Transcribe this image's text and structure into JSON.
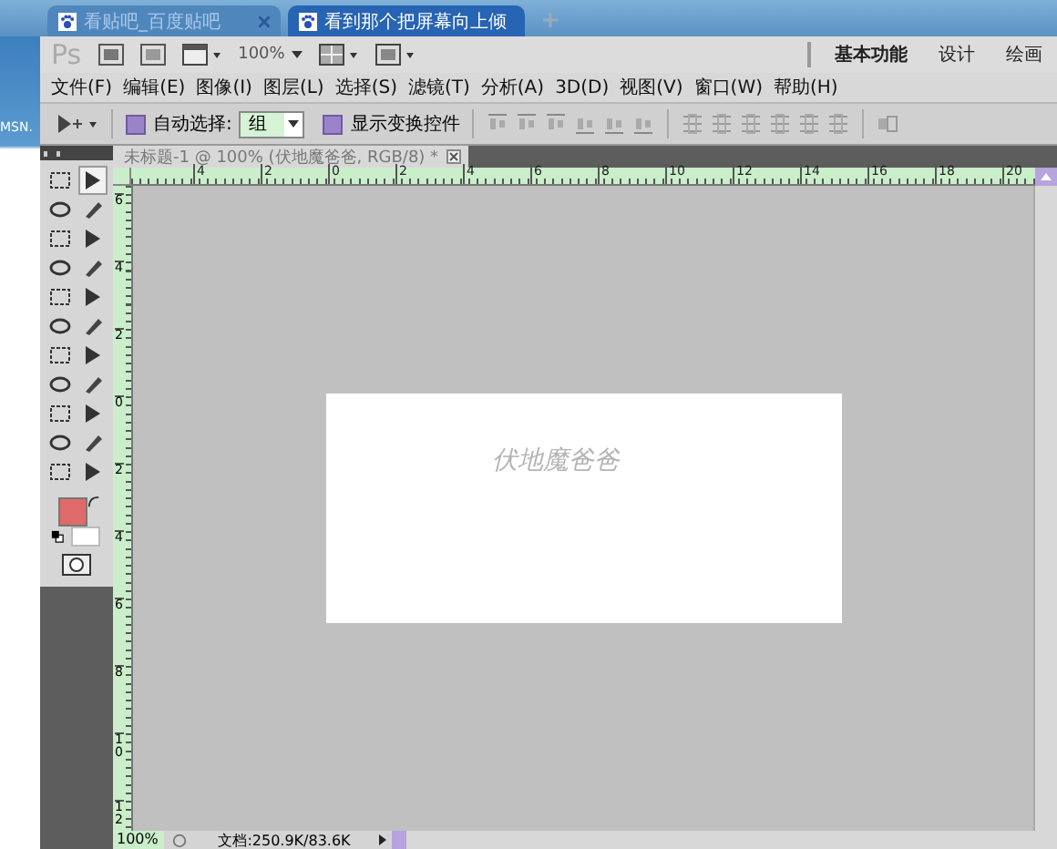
{
  "browser_tabs": [
    {
      "label": "看贴吧_百度贴吧",
      "selected": false
    },
    {
      "label": "看到那个把屏幕向上倾",
      "selected": true
    }
  ],
  "desktop": {
    "label": "MSN."
  },
  "app_bar": {
    "logo": "Ps",
    "zoom": "100%",
    "workspaces": [
      {
        "label": "基本功能",
        "selected": true
      },
      {
        "label": "设计",
        "selected": false
      },
      {
        "label": "绘画",
        "selected": false
      }
    ]
  },
  "menu": [
    "文件(F)",
    "编辑(E)",
    "图像(I)",
    "图层(L)",
    "选择(S)",
    "滤镜(T)",
    "分析(A)",
    "3D(D)",
    "视图(V)",
    "窗口(W)",
    "帮助(H)"
  ],
  "options_bar": {
    "auto_select_label": "自动选择:",
    "auto_select_checked": true,
    "auto_select_value": "组",
    "transform_label": "显示变换控件",
    "transform_checked": true
  },
  "document": {
    "tab_title": "未标题-1 @ 100% (伏地魔爸爸, RGB/8) *",
    "canvas_text": "伏地魔爸爸",
    "top_ruler": [
      "4",
      "2",
      "0",
      "2",
      "4",
      "6",
      "8",
      "10",
      "12",
      "14",
      "16",
      "18",
      "20"
    ],
    "left_ruler": [
      "6",
      "4",
      "2",
      "0",
      "2",
      "4",
      "6",
      "8",
      "10",
      "12"
    ]
  },
  "status_bar": {
    "zoom": "100%",
    "doc_info": "文档:250.9K/83.6K"
  }
}
